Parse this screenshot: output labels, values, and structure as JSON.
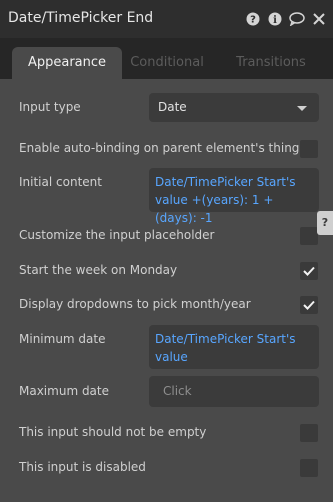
{
  "window": {
    "title": "Date/TimePicker End",
    "icons": [
      "help-icon",
      "info-icon",
      "comment-icon",
      "close-icon"
    ]
  },
  "tabs": [
    {
      "label": "Appearance",
      "active": true
    },
    {
      "label": "Conditional",
      "active": false
    },
    {
      "label": "Transitions",
      "active": false
    }
  ],
  "fields": {
    "input_type": {
      "label": "Input type",
      "value": "Date"
    },
    "auto_binding": {
      "label": "Enable auto-binding on parent element's thing",
      "checked": false
    },
    "initial_content": {
      "label": "Initial content",
      "value": "Date/TimePicker Start's value +(years): 1 +(days): -1"
    },
    "customize_placeholder": {
      "label": "Customize the input placeholder",
      "checked": false
    },
    "week_monday": {
      "label": "Start the week on Monday",
      "checked": true
    },
    "dropdowns_month_year": {
      "label": "Display dropdowns to pick month/year",
      "checked": true
    },
    "minimum_date": {
      "label": "Minimum date",
      "value": "Date/TimePicker Start's value"
    },
    "maximum_date": {
      "label": "Maximum date",
      "placeholder": "Click"
    },
    "not_empty": {
      "label": "This input should not be empty",
      "checked": false
    },
    "disabled": {
      "label": "This input is disabled",
      "checked": false
    }
  },
  "side_tab": {
    "label": "?"
  },
  "colors": {
    "dynamic_text": "#58a6ff",
    "panel": "#4a4a4a"
  }
}
